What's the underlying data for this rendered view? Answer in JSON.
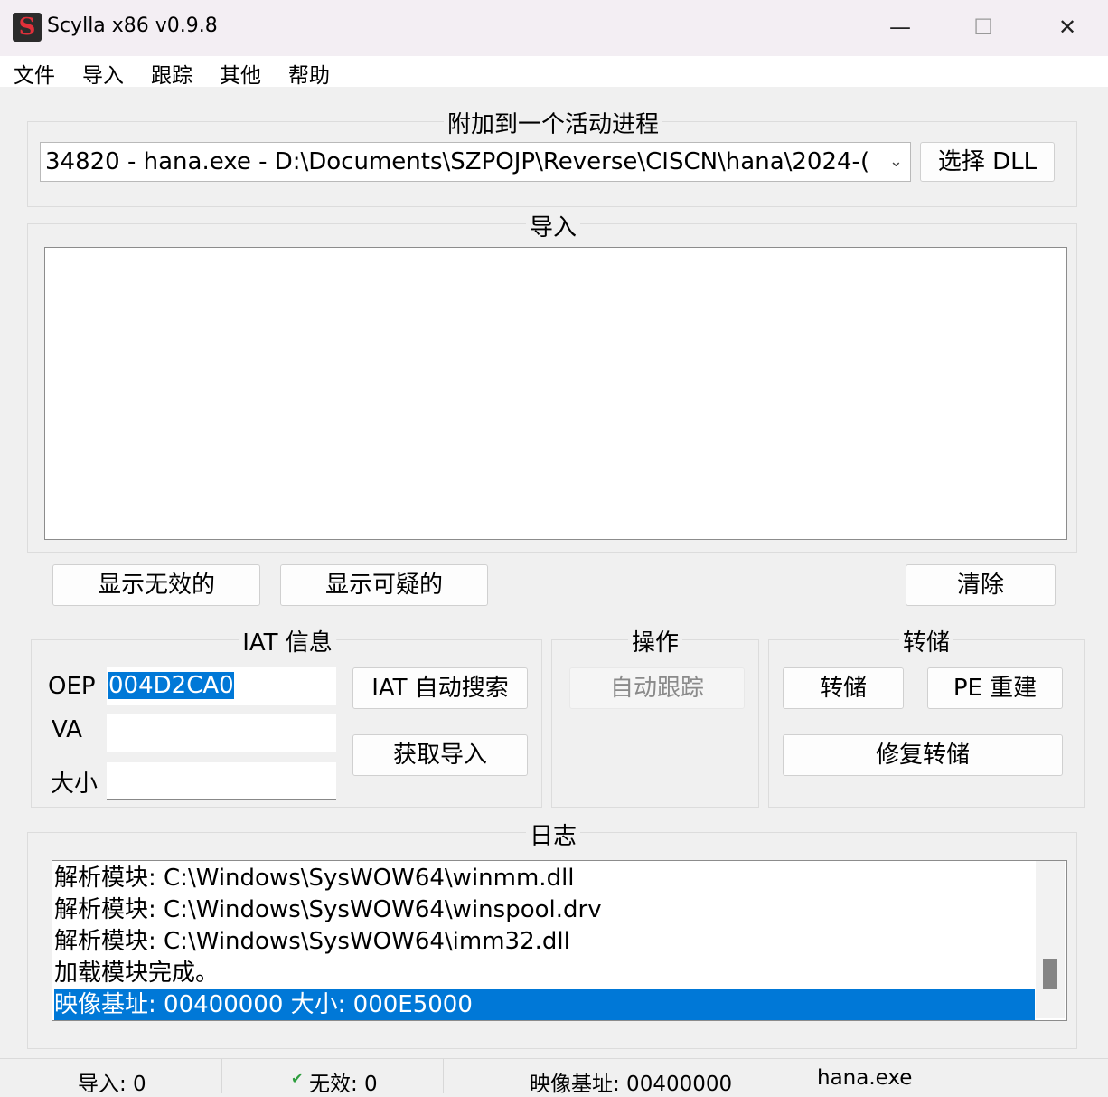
{
  "window": {
    "title": "Scylla x86 v0.9.8",
    "icon_letter": "S",
    "minimize_glyph": "—",
    "maximize_glyph": "☐",
    "close_glyph": "✕"
  },
  "menu": [
    "文件",
    "导入",
    "跟踪",
    "其他",
    "帮助"
  ],
  "attach": {
    "title": "附加到一个活动进程",
    "process_value": "34820 - hana.exe - D:\\Documents\\SZPOJP\\Reverse\\CISCN\\hana\\2024-(",
    "pick_dll": "选择 DLL"
  },
  "imports": {
    "title": "导入",
    "show_invalid": "显示无效的",
    "show_suspect": "显示可疑的",
    "clear": "清除"
  },
  "iat": {
    "title": "IAT 信息",
    "oep_label": "OEP",
    "oep_value": "004D2CA0",
    "va_label": "VA",
    "size_label": "大小",
    "autosearch": "IAT 自动搜索",
    "get_imports": "获取导入"
  },
  "actions": {
    "title": "操作",
    "autotrace": "自动跟踪"
  },
  "dump": {
    "title": "转储",
    "dump": "转储",
    "pe_rebuild": "PE 重建",
    "fix_dump": "修复转储"
  },
  "log": {
    "title": "日志",
    "lines": [
      "解析模块: C:\\Windows\\SysWOW64\\winmm.dll",
      "解析模块: C:\\Windows\\SysWOW64\\winspool.drv",
      "解析模块: C:\\Windows\\SysWOW64\\imm32.dll",
      "加载模块完成。",
      "映像基址: 00400000 大小: 000E5000"
    ]
  },
  "status": {
    "imports": "导入: 0",
    "invalid": "无效: 0",
    "check_glyph": "✔",
    "imagebase": "映像基址: 00400000",
    "module": "hana.exe"
  },
  "colors": {
    "accent": "#0078d7",
    "check": "#2e9e3e"
  }
}
